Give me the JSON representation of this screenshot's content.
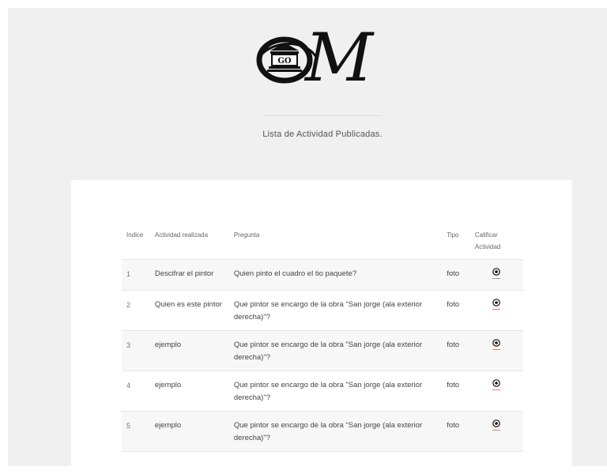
{
  "header": {
    "subtitle": "Lista de Actividad Publicadas.",
    "logo": {
      "letter": "M",
      "badge": "GO"
    }
  },
  "table": {
    "columns": {
      "index": "Indice",
      "activity": "Actividad realizada",
      "question": "Pregunta",
      "type": "Tipo",
      "rate": "Calificar Actividad"
    },
    "rows": [
      {
        "index": "1",
        "activity": "Descifrar el pintor",
        "question": "Quien pinto el cuadro el tio paquete?",
        "type": "foto",
        "icon": "eye-icon"
      },
      {
        "index": "2",
        "activity": "Quien es este pintor",
        "question": "Que pintor se encargo de la obra \"San jorge (ala exterior derecha)\"?",
        "type": "foto",
        "icon": "eye-icon"
      },
      {
        "index": "3",
        "activity": "ejemplo",
        "question": "Que pintor se encargo de la obra \"San jorge (ala exterior derecha)\"?",
        "type": "foto",
        "icon": "eye-icon"
      },
      {
        "index": "4",
        "activity": "ejemplo",
        "question": "Que pintor se encargo de la obra \"San jorge (ala exterior derecha)\"?",
        "type": "foto",
        "icon": "eye-icon"
      },
      {
        "index": "5",
        "activity": "ejemplo",
        "question": "Que pintor se encargo de la obra \"San jorge (ala exterior derecha)\"?",
        "type": "foto",
        "icon": "eye-icon"
      }
    ]
  },
  "colors": {
    "background": "#f0f0f0",
    "card": "#ffffff",
    "accent": "#e07a6a"
  }
}
